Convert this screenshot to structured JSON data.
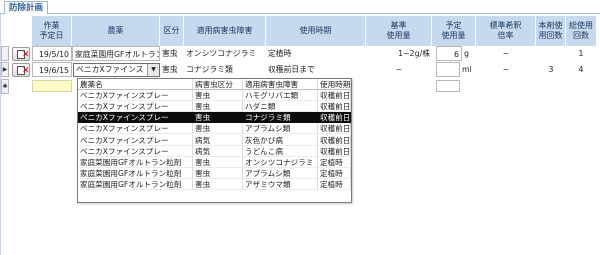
{
  "tab": {
    "label": "防除計画"
  },
  "headers": {
    "planned_date": "作業\n予定日",
    "pesticide": "農薬",
    "category": "区分",
    "pest": "適用病害虫障害",
    "timing": "使用時期",
    "std_amount": "基準\n使用量",
    "planned_amount": "予定\n使用量",
    "dilution": "標準希釈\n倍率",
    "uses_this": "本剤使\n用回数",
    "uses_total": "総使用\n回数"
  },
  "rows": [
    {
      "date": "19/5/10",
      "pesticide": "家庭菜園用GFオルトラン",
      "category": "害虫",
      "pest": "オンシツコナジラミ",
      "timing": "定植時",
      "std_amount": "1~2g/株",
      "planned_amount": "6",
      "unit": "g",
      "dilution": "~",
      "uses_this": "",
      "uses_total": "1"
    },
    {
      "date": "19/6/15",
      "pesticide": "ベニカXファインス",
      "category": "害虫",
      "pest": "コナジラミ類",
      "timing": "収穫前日まで",
      "std_amount": "~",
      "planned_amount": "",
      "unit": "ml",
      "dilution": "~",
      "uses_this": "3",
      "uses_total": "4"
    }
  ],
  "row_markers": {
    "current": "▶",
    "new": "✱"
  },
  "dropdown": {
    "headers": [
      "農薬名",
      "病害虫区分",
      "適用病害虫障害",
      "使用時期"
    ],
    "items": [
      [
        "ベニカXファインスプレー",
        "害虫",
        "ハモグリバエ類",
        "収穫前日まで"
      ],
      [
        "ベニカXファインスプレー",
        "害虫",
        "ハダニ類",
        "収穫前日まで"
      ],
      [
        "ベニカXファインスプレー",
        "害虫",
        "コナジラミ類",
        "収穫前日まで"
      ],
      [
        "ベニカXファインスプレー",
        "害虫",
        "アブラムシ類",
        "収穫前日まで"
      ],
      [
        "ベニカXファインスプレー",
        "病気",
        "灰色かび病",
        "収穫前日まで"
      ],
      [
        "ベニカXファインスプレー",
        "病気",
        "うどんこ病",
        "収穫前日まで"
      ],
      [
        "家庭菜園用GFオルトラン粒剤",
        "害虫",
        "オンシツコナジラミ",
        "定植時"
      ],
      [
        "家庭菜園用GFオルトラン粒剤",
        "害虫",
        "アブラムシ類",
        "定植時"
      ],
      [
        "家庭菜園用GFオルトラン粒剤",
        "害虫",
        "アザミウマ類",
        "定植時"
      ]
    ],
    "selected_index": 2
  },
  "colors": {
    "header_bg": "#c7d9ee",
    "header_text": "#1c3a66",
    "new_row_bg": "#fffbc8",
    "highlight": "#0c0c0c",
    "delete_x": "#d40000"
  },
  "icons": {
    "delete": "delete-record-icon",
    "dropdown": "chevron-down-icon"
  }
}
